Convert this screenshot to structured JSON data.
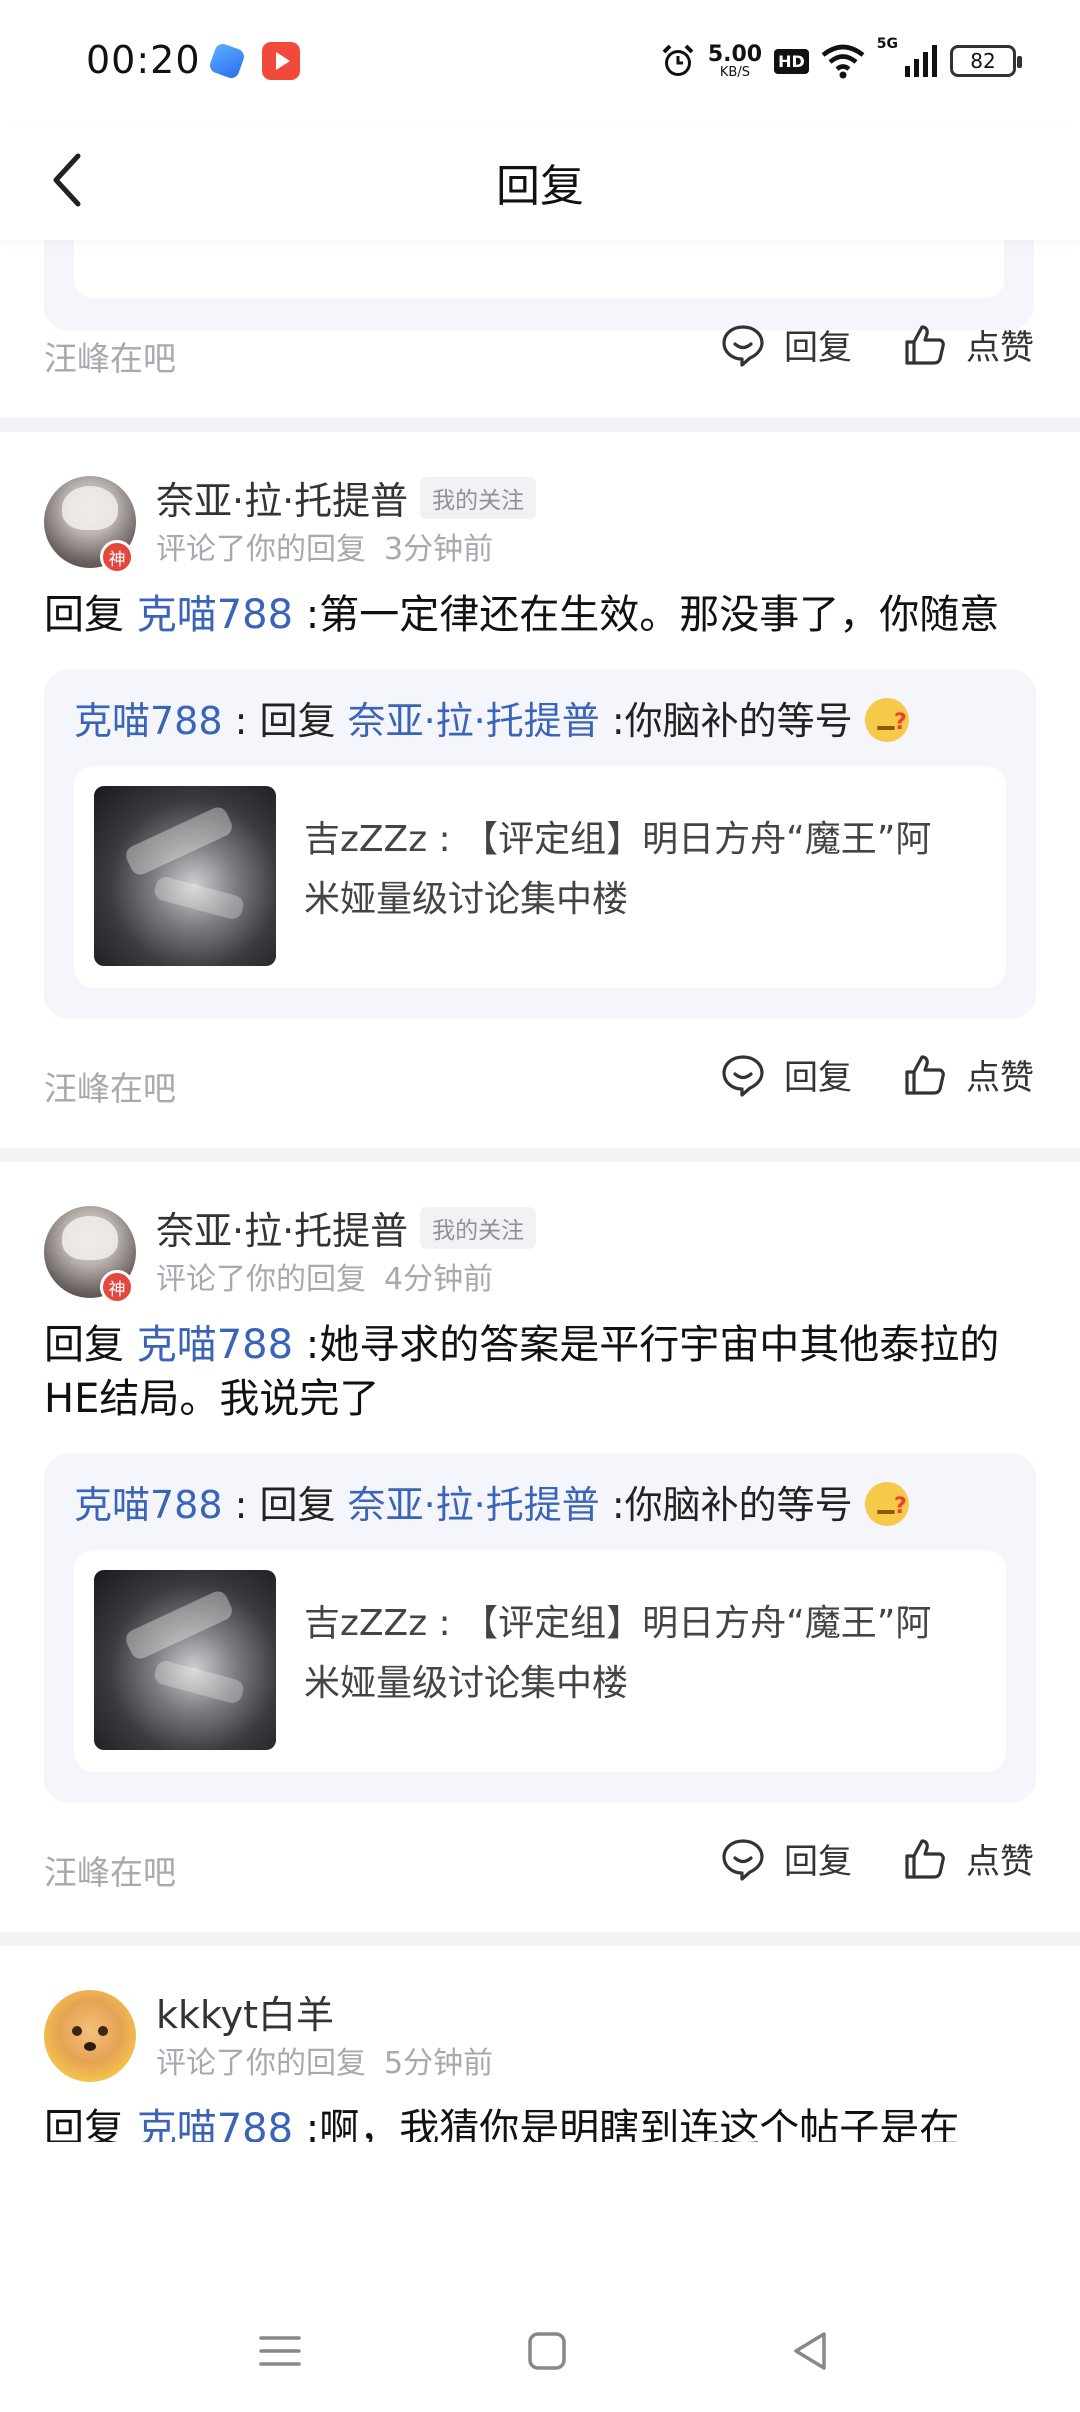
{
  "status_bar": {
    "time": "00:20",
    "net_speed_value": "5.00",
    "net_speed_unit": "KB/S",
    "hd_label": "HD",
    "network_type": "5G",
    "battery": "82"
  },
  "header": {
    "title": "回复"
  },
  "top_item": {
    "forum": "汪峰在吧",
    "reply_label": "回复",
    "like_label": "点赞"
  },
  "items": [
    {
      "username": "奈亚·拉·托提普",
      "follow_tag": "我的关注",
      "badge": "神",
      "action": "评论了你的回复",
      "time": "3分钟前",
      "reply_prefix": "回复",
      "reply_mention": "克喵788",
      "reply_text": " :第一定律还在生效。那没事了，你随意",
      "quote_author": "克喵788",
      "quote_sep": " : 回复 ",
      "quote_mention": "奈亚·拉·托提普",
      "quote_text": " :你脑补的等号",
      "post_text": "吉zZZz : 【评定组】明日方舟“魔王”阿米娅量级讨论集中楼",
      "forum": "汪峰在吧",
      "reply_label": "回复",
      "like_label": "点赞"
    },
    {
      "username": "奈亚·拉·托提普",
      "follow_tag": "我的关注",
      "badge": "神",
      "action": "评论了你的回复",
      "time": "4分钟前",
      "reply_prefix": "回复",
      "reply_mention": "克喵788",
      "reply_text": " :她寻求的答案是平行宇宙中其他泰拉的HE结局。我说完了",
      "quote_author": "克喵788",
      "quote_sep": " : 回复 ",
      "quote_mention": "奈亚·拉·托提普",
      "quote_text": " :你脑补的等号",
      "post_text": "吉zZZz : 【评定组】明日方舟“魔王”阿米娅量级讨论集中楼",
      "forum": "汪峰在吧",
      "reply_label": "回复",
      "like_label": "点赞"
    },
    {
      "username": "kkkyt白羊",
      "action": "评论了你的回复",
      "time": "5分钟前",
      "reply_prefix": "回复",
      "reply_mention": "克喵788",
      "reply_text": " :啊，我猜你是明瞎到连这个帖子是在"
    }
  ],
  "icons": {
    "back": "chevron-left-icon",
    "reply": "comment-bubble-icon",
    "like": "thumbs-up-icon",
    "nav_menu": "menu-lines-icon",
    "nav_home": "square-home-icon",
    "nav_back": "triangle-back-icon"
  },
  "colors": {
    "mention": "#3a64b8",
    "muted": "#a7a9b0",
    "quote_bg": "#f5f6fc",
    "badge": "#e5473d"
  }
}
